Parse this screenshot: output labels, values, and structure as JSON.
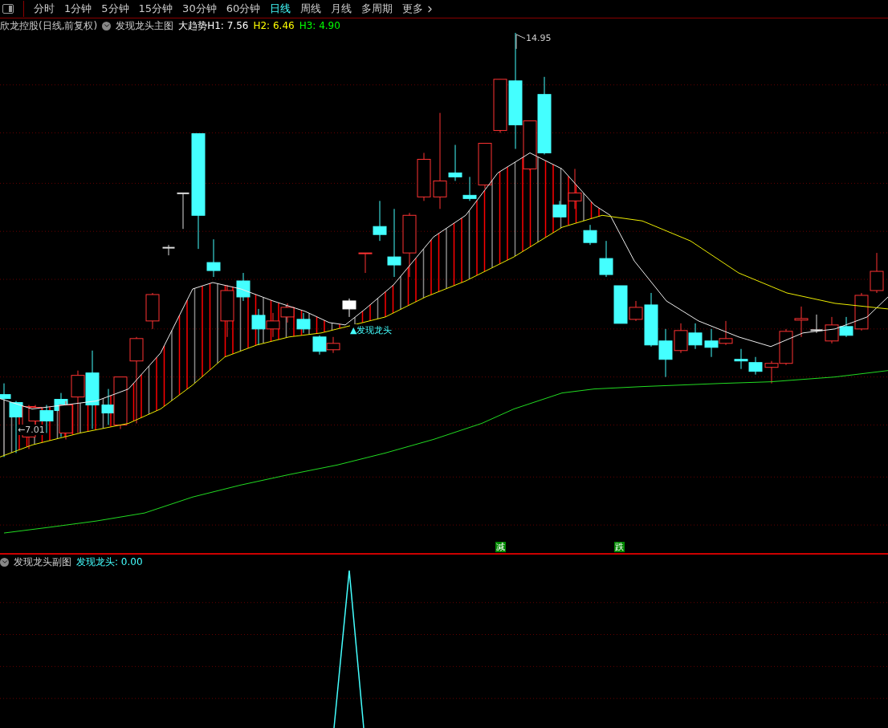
{
  "toolbar": {
    "items": [
      {
        "label": "分时",
        "selected": false
      },
      {
        "label": "1分钟",
        "selected": false
      },
      {
        "label": "5分钟",
        "selected": false
      },
      {
        "label": "15分钟",
        "selected": false
      },
      {
        "label": "30分钟",
        "selected": false
      },
      {
        "label": "60分钟",
        "selected": false
      },
      {
        "label": "日线",
        "selected": true
      },
      {
        "label": "周线",
        "selected": false
      },
      {
        "label": "月线",
        "selected": false
      },
      {
        "label": "多周期",
        "selected": false
      }
    ],
    "more": "更多"
  },
  "main_chart": {
    "stock": "欣龙控股(日线,前复权)",
    "indicator": "发现龙头主图",
    "fields": [
      {
        "label": "大趋势H1: 7.56",
        "color": "#ffffff"
      },
      {
        "label": "H2: 6.46",
        "color": "#ffff00"
      },
      {
        "label": "H3: 4.90",
        "color": "#00ff00"
      }
    ],
    "high_label": "14.95",
    "low_label": "←7.01",
    "signal_label": "▲发现龙头",
    "markers": [
      "减",
      "跌"
    ]
  },
  "sub_chart": {
    "indicator": "发现龙头副图",
    "reading": "发现龙头: 0.00"
  }
}
